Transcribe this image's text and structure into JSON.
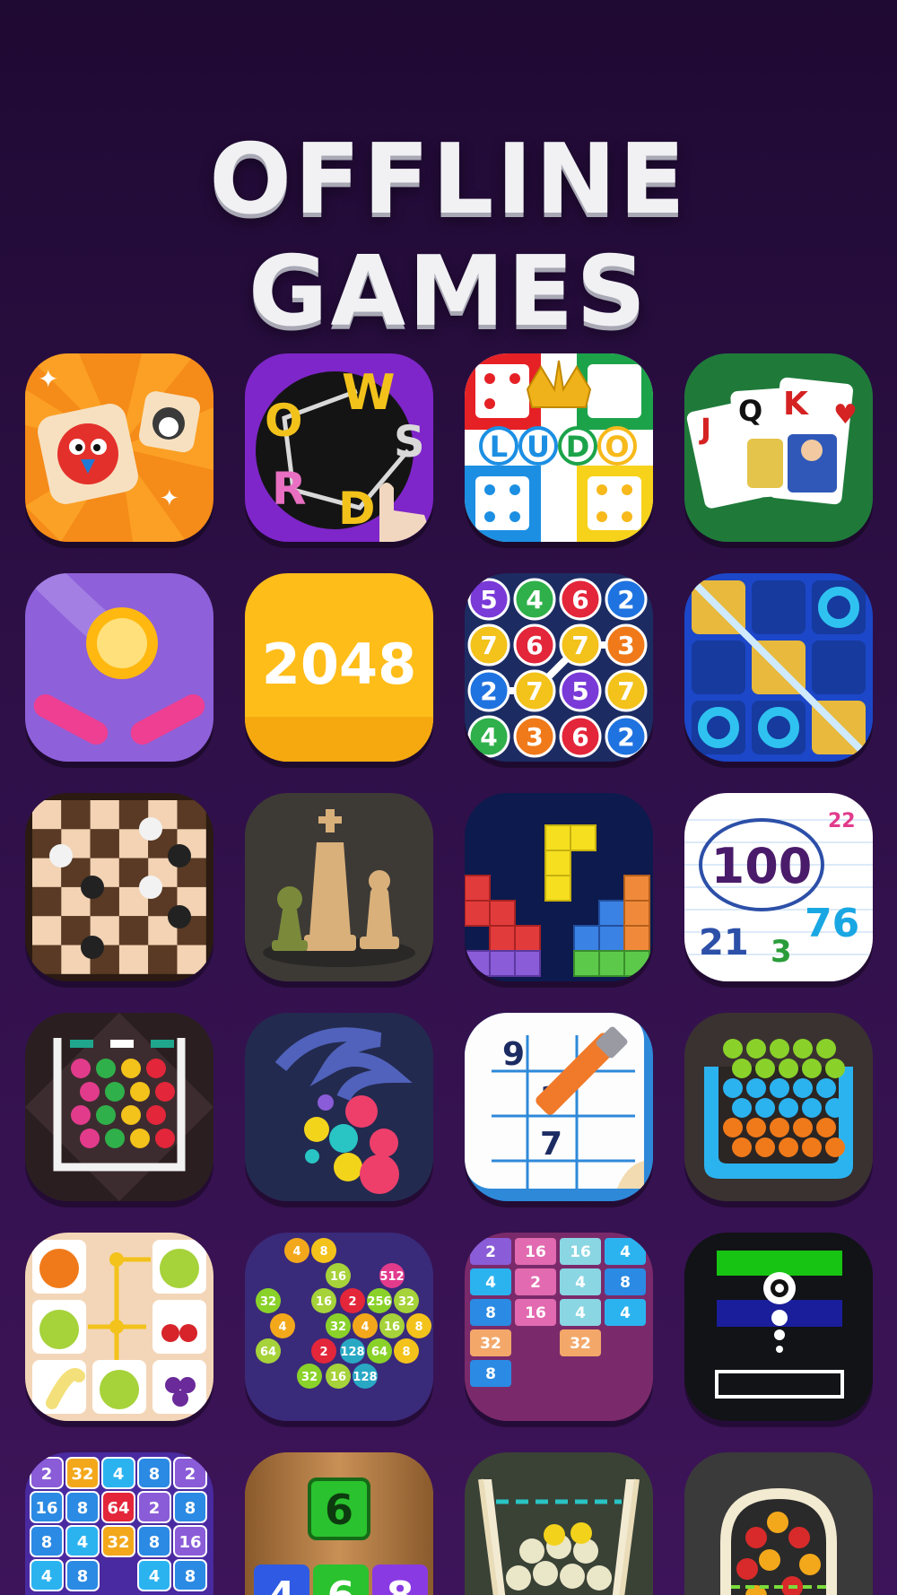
{
  "header": {
    "title": "OFFLINE GAMES"
  },
  "colors": {
    "background": "#2a0d40",
    "title": "#f1f1f4"
  },
  "apps": [
    {
      "name": "Tile Match",
      "icon": "tile-match-icon"
    },
    {
      "name": "Word Connect",
      "icon": "word-connect-icon",
      "letters": [
        "W",
        "O",
        "R",
        "D",
        "S"
      ]
    },
    {
      "name": "Ludo",
      "icon": "ludo-icon",
      "letters": [
        "L",
        "U",
        "D",
        "O"
      ]
    },
    {
      "name": "Solitaire",
      "icon": "solitaire-icon",
      "letters": [
        "J",
        "Q",
        "K"
      ]
    },
    {
      "name": "Pinball",
      "icon": "pinball-icon"
    },
    {
      "name": "2048",
      "icon": "2048-icon",
      "label": "2048"
    },
    {
      "name": "Number Match",
      "icon": "number-match-icon",
      "numbers": [
        "5",
        "4",
        "6",
        "2",
        "7",
        "6",
        "7",
        "3",
        "2",
        "7",
        "5",
        "7",
        "4",
        "3",
        "6",
        "2"
      ]
    },
    {
      "name": "Tic Tac Toe",
      "icon": "tic-tac-toe-icon"
    },
    {
      "name": "Checkers",
      "icon": "checkers-icon"
    },
    {
      "name": "Chess",
      "icon": "chess-icon"
    },
    {
      "name": "Block Puzzle",
      "icon": "block-puzzle-icon"
    },
    {
      "name": "Number Puzzle",
      "icon": "number-puzzle-icon",
      "numbers": [
        "100",
        "22",
        "21",
        "3",
        "76"
      ]
    },
    {
      "name": "Ball Drop",
      "icon": "ball-drop-icon"
    },
    {
      "name": "Hole Balls",
      "icon": "hole-balls-icon"
    },
    {
      "name": "Sudoku",
      "icon": "sudoku-icon",
      "numbers": [
        "9",
        "3",
        "7"
      ]
    },
    {
      "name": "Balls Cup",
      "icon": "balls-cup-icon"
    },
    {
      "name": "Onet Fruit",
      "icon": "onet-fruit-icon"
    },
    {
      "name": "Hexa Merge",
      "icon": "hexa-merge-icon",
      "numbers": [
        "4",
        "8",
        "16",
        "512",
        "32",
        "16",
        "2",
        "256",
        "32",
        "4",
        "32",
        "4",
        "16",
        "8",
        "64",
        "2",
        "128",
        "64",
        "8",
        "32",
        "16",
        "128"
      ]
    },
    {
      "name": "Merge Blocks",
      "icon": "merge-blocks-icon",
      "numbers": [
        "2",
        "16",
        "16",
        "4",
        "4",
        "2",
        "4",
        "8",
        "8",
        "16",
        "4",
        "4",
        "32",
        "32",
        "8"
      ]
    },
    {
      "name": "Ball Tower",
      "icon": "ball-tower-icon"
    },
    {
      "name": "Number Grid",
      "icon": "number-grid-icon",
      "numbers": [
        "2",
        "32",
        "4",
        "8",
        "2",
        "16",
        "8",
        "64",
        "2",
        "8",
        "8",
        "4",
        "32",
        "8",
        "16",
        "4",
        "8",
        "4",
        "8"
      ]
    },
    {
      "name": "Drop Number",
      "icon": "drop-number-icon",
      "numbers": [
        "6",
        "4",
        "6",
        "8"
      ]
    },
    {
      "name": "Cup Balls",
      "icon": "cup-balls-icon"
    },
    {
      "name": "Ball Sort",
      "icon": "ball-sort-icon"
    }
  ]
}
